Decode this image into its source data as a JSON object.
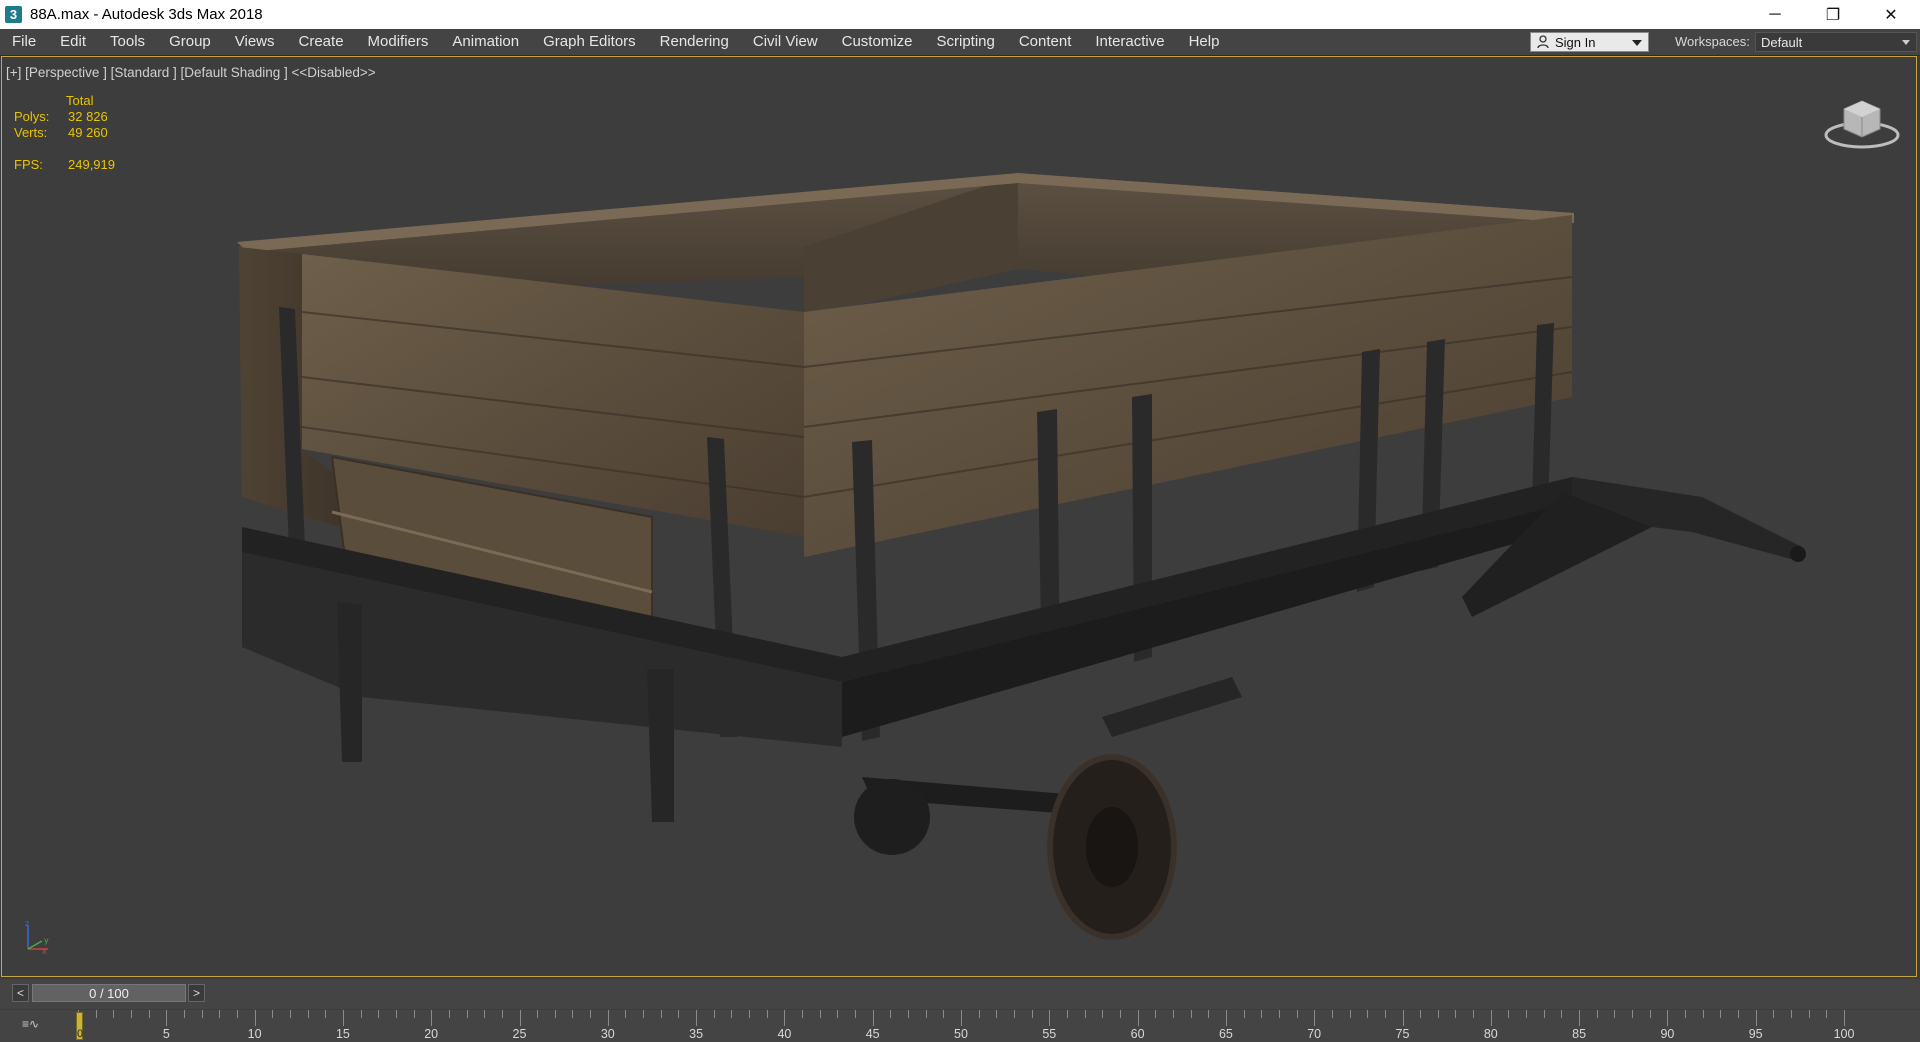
{
  "window": {
    "app_icon_glyph": "3",
    "title": "88A.max - Autodesk 3ds Max 2018",
    "controls": {
      "minimize": "─",
      "restore": "❐",
      "close": "✕"
    }
  },
  "menu": {
    "items": [
      "File",
      "Edit",
      "Tools",
      "Group",
      "Views",
      "Create",
      "Modifiers",
      "Animation",
      "Graph Editors",
      "Rendering",
      "Civil View",
      "Customize",
      "Scripting",
      "Content",
      "Interactive",
      "Help"
    ],
    "sign_in": "Sign In",
    "workspaces_label": "Workspaces:",
    "workspace_value": "Default"
  },
  "viewport": {
    "label": "[+] [Perspective ] [Standard ] [Default Shading ]  <<Disabled>>",
    "stats": {
      "total_header": "Total",
      "polys_label": "Polys:",
      "polys_value": "32 826",
      "verts_label": "Verts:",
      "verts_value": "49 260",
      "fps_label": "FPS:",
      "fps_value": "249,919"
    },
    "object_icon": "wooden-trailer-model",
    "viewcube_icon": "viewcube-icon",
    "axis": {
      "z": "z",
      "x": "x",
      "y": "y"
    },
    "border_color": "#c7a44a"
  },
  "timeline": {
    "prev": "<",
    "next": ">",
    "frame_display": "0 / 100",
    "curve_button": "≡∿",
    "playhead_frame": "0",
    "ticks": [
      "5",
      "10",
      "15",
      "20",
      "25",
      "30",
      "35",
      "40",
      "45",
      "50",
      "55",
      "60",
      "65",
      "70",
      "75",
      "80",
      "85",
      "90",
      "95",
      "100"
    ],
    "range": [
      0,
      100
    ]
  }
}
